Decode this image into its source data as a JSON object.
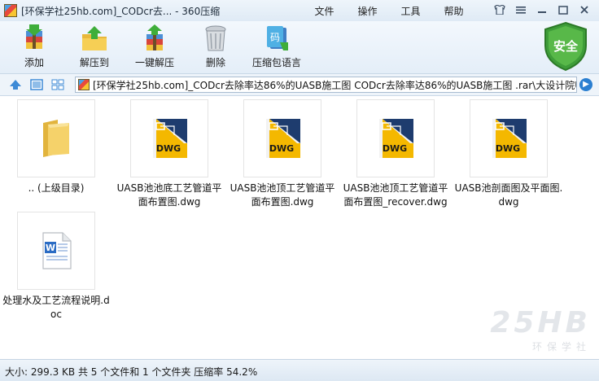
{
  "window": {
    "title": "[环保学社25hb.com]_CODcr去... - 360压缩",
    "menu": [
      "文件",
      "操作",
      "工具",
      "帮助"
    ]
  },
  "toolbar": {
    "buttons": [
      {
        "label": "添加",
        "icon": "add-archive-icon"
      },
      {
        "label": "解压到",
        "icon": "extract-to-icon"
      },
      {
        "label": "一键解压",
        "icon": "one-click-extract-icon"
      },
      {
        "label": "删除",
        "icon": "delete-trash-icon"
      },
      {
        "label": "压缩包语言",
        "icon": "archive-language-icon"
      }
    ],
    "security_badge": "安全"
  },
  "pathbar": {
    "path": "[环保学社25hb.com]_CODcr去除率达86%的UASB施工图 CODcr去除率达86%的UASB施工图 .rar\\大设计院U/"
  },
  "files": [
    {
      "name": ".. (上级目录)",
      "type": "folder"
    },
    {
      "name": "UASB池池底工艺管道平面布置图.dwg",
      "type": "dwg",
      "badge": "DWG"
    },
    {
      "name": "UASB池池顶工艺管道平面布置图.dwg",
      "type": "dwg",
      "badge": "DWG"
    },
    {
      "name": "UASB池池顶工艺管道平面布置图_recover.dwg",
      "type": "dwg",
      "badge": "DWG"
    },
    {
      "name": "UASB池剖面图及平面图.dwg",
      "type": "dwg",
      "badge": "DWG"
    },
    {
      "name": "处理水及工艺流程说明.doc",
      "type": "doc"
    }
  ],
  "status": {
    "text": "大小: 299.3 KB 共 5 个文件和 1 个文件夹 压缩率 54.2%"
  },
  "watermark": {
    "brand": "25HB",
    "subtitle": "环保学社"
  }
}
